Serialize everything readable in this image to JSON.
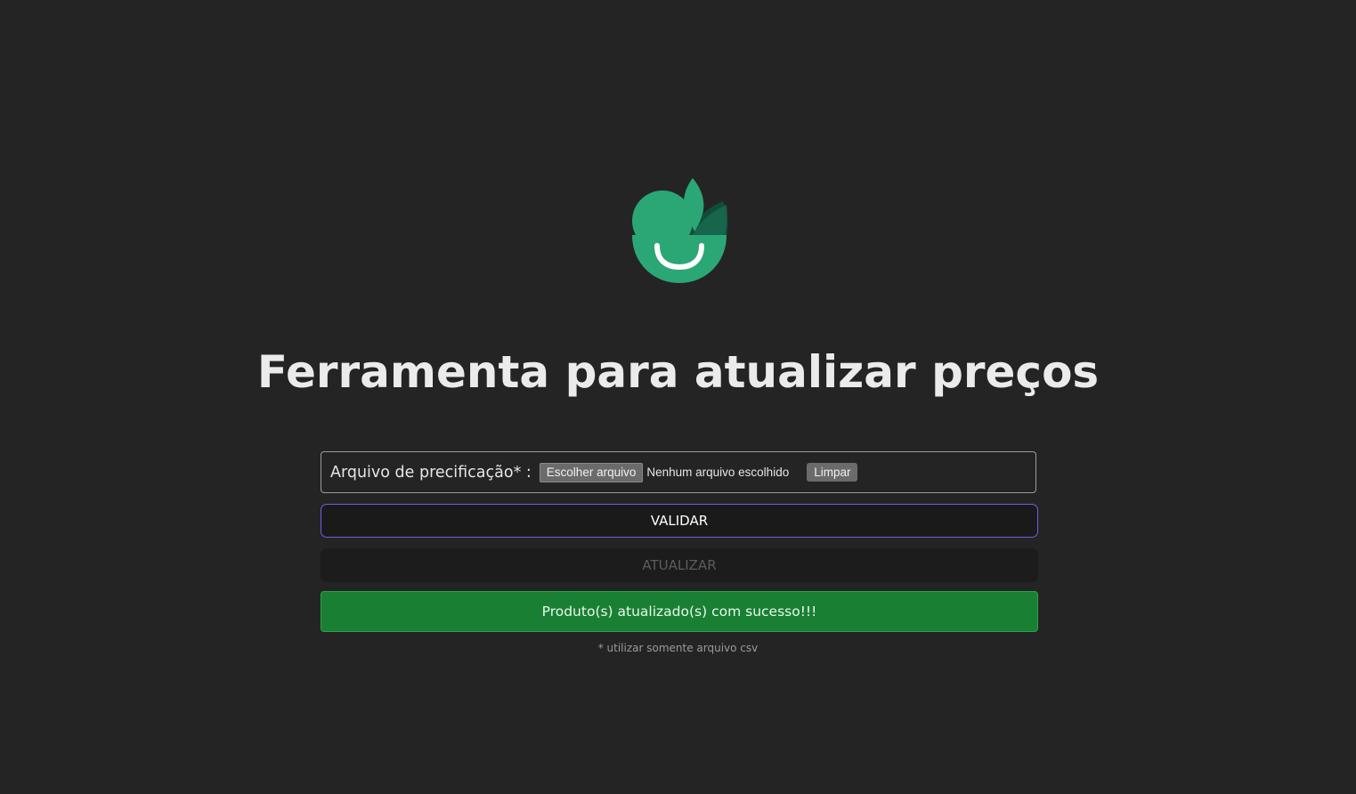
{
  "logo": {
    "icon": "leaf-bowl-smile-logo",
    "colors": {
      "primary": "#2aa775",
      "dark": "#114c3b",
      "mid": "#1e7a57",
      "smile": "#ffffff"
    }
  },
  "title": "Ferramenta para atualizar preços",
  "file_input": {
    "label": "Arquivo de precificação* :",
    "choose_label": "Escolher arquivo",
    "status": "Nenhum arquivo escolhido",
    "clear_label": "Limpar"
  },
  "buttons": {
    "validate_label": "VALIDAR",
    "update_label": "ATUALIZAR"
  },
  "alert": {
    "message": "Produto(s) atualizado(s) com sucesso!!!",
    "color": "#198033"
  },
  "footnote": "* utilizar somente arquivo csv"
}
